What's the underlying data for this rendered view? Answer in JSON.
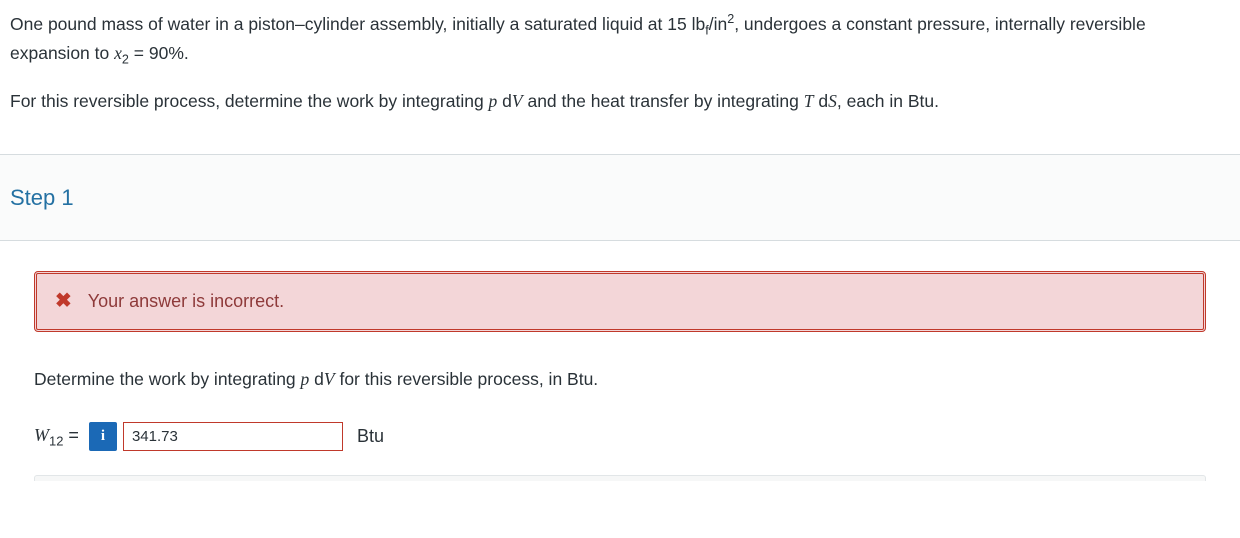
{
  "problem": {
    "para1_a": "One pound mass of water in a piston–cylinder assembly, initially a saturated liquid at 15 lb",
    "para1_sub": "f",
    "para1_b": "/in",
    "para1_sup": "2",
    "para1_c": ", undergoes a constant pressure, internally reversible expansion to ",
    "para1_var": "x",
    "para1_varsub": "2",
    "para1_d": " = 90%.",
    "para2_a": "For this reversible process, determine the work by integrating ",
    "para2_i1": "p",
    "para2_b": " d",
    "para2_i2": "V",
    "para2_c": " and the heat transfer by integrating ",
    "para2_i3": "T",
    "para2_d": " d",
    "para2_i4": "S",
    "para2_e": ", each in Btu."
  },
  "step": {
    "heading": "Step 1",
    "feedback_icon": "✖",
    "feedback_msg": "Your answer is incorrect.",
    "sub_prompt_a": "Determine the work by integrating ",
    "sub_prompt_i1": "p",
    "sub_prompt_b": " d",
    "sub_prompt_i2": "V",
    "sub_prompt_c": " for this reversible process, in Btu.",
    "var_main": "W",
    "var_sub": "12",
    "equals": " = ",
    "info_badge": "i",
    "answer_value": "341.73",
    "unit": "Btu"
  }
}
